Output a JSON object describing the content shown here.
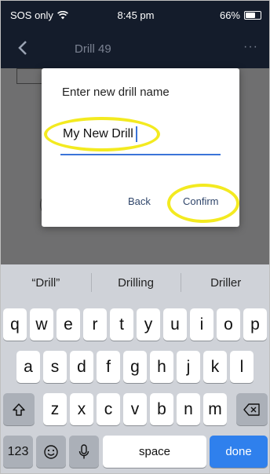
{
  "status_bar": {
    "carrier": "SOS only",
    "time": "8:45 pm",
    "battery": "66%",
    "battery_level": 0.66
  },
  "app_bar": {
    "back_icon": "chevron-left-icon",
    "title": "Drill 49",
    "more_icon": "ellipsis-icon",
    "more_glyph": "···"
  },
  "dialog": {
    "heading": "Enter new drill name",
    "input_value": "My New Drill",
    "back_label": "Back",
    "confirm_label": "Confirm"
  },
  "annotation_color": "#f3ea20",
  "keyboard": {
    "suggestions": [
      "“Drill”",
      "Drilling",
      "Driller"
    ],
    "row1": [
      "q",
      "w",
      "e",
      "r",
      "t",
      "y",
      "u",
      "i",
      "o",
      "p"
    ],
    "row2": [
      "a",
      "s",
      "d",
      "f",
      "g",
      "h",
      "j",
      "k",
      "l"
    ],
    "row3": [
      "z",
      "x",
      "c",
      "v",
      "b",
      "n",
      "m"
    ],
    "numbers_label": "123",
    "space_label": "space",
    "done_label": "done",
    "done_color": "#2f80ed"
  }
}
